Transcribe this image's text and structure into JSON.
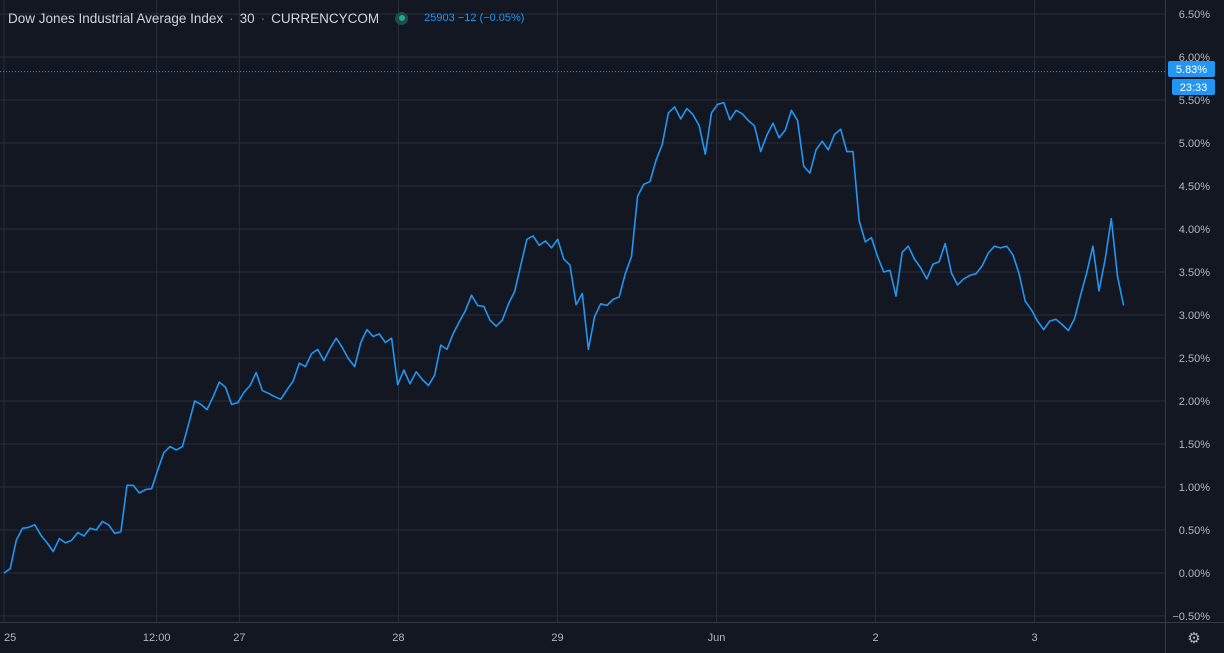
{
  "legend": {
    "title": "Dow Jones Industrial Average Index",
    "interval": "30",
    "source": "CURRENCYCOM",
    "separator": "·",
    "value_text": "25903  −12 (−0.05%)"
  },
  "badges": {
    "last_value": "5.83%",
    "countdown": "23:33"
  },
  "colors": {
    "background": "#131722",
    "grid": "#2a2e39",
    "line": "#2196f3",
    "text": "#b2b5be",
    "status": "#26a69a"
  },
  "icons": {
    "settings": "gear-icon"
  },
  "chart_data": {
    "type": "line",
    "y_unit": "percent",
    "ylim": [
      -0.5,
      6.5
    ],
    "y_ticks": [
      {
        "value": 6.5,
        "label": "6.50%"
      },
      {
        "value": 6.0,
        "label": "6.00%"
      },
      {
        "value": 5.5,
        "label": "5.50%"
      },
      {
        "value": 5.0,
        "label": "5.00%"
      },
      {
        "value": 4.5,
        "label": "4.50%"
      },
      {
        "value": 4.0,
        "label": "4.00%"
      },
      {
        "value": 3.5,
        "label": "3.50%"
      },
      {
        "value": 3.0,
        "label": "3.00%"
      },
      {
        "value": 2.5,
        "label": "2.50%"
      },
      {
        "value": 2.0,
        "label": "2.00%"
      },
      {
        "value": 1.5,
        "label": "1.50%"
      },
      {
        "value": 1.0,
        "label": "1.00%"
      },
      {
        "value": 0.5,
        "label": "0.50%"
      },
      {
        "value": 0.0,
        "label": "0.00%"
      },
      {
        "value": -0.5,
        "label": "−0.50%"
      }
    ],
    "x_ticks": [
      {
        "label": "25",
        "bar": 0
      },
      {
        "label": "12:00",
        "bar": 24
      },
      {
        "label": "27",
        "bar": 37
      },
      {
        "label": "28",
        "bar": 62
      },
      {
        "label": "29",
        "bar": 87
      },
      {
        "label": "Jun",
        "bar": 112
      },
      {
        "label": "2",
        "bar": 137
      },
      {
        "label": "3",
        "bar": 162
      }
    ],
    "bars_total": 177,
    "grid": true,
    "last_value_line": 5.83,
    "series": [
      {
        "values": [
          0.0,
          0.05,
          0.38,
          0.52,
          0.53,
          0.56,
          0.44,
          0.35,
          0.25,
          0.4,
          0.35,
          0.38,
          0.47,
          0.43,
          0.52,
          0.5,
          0.6,
          0.56,
          0.46,
          0.48,
          1.02,
          1.02,
          0.93,
          0.97,
          0.98,
          1.2,
          1.4,
          1.47,
          1.43,
          1.47,
          1.73,
          2.0,
          1.96,
          1.9,
          2.05,
          2.22,
          2.16,
          1.96,
          1.98,
          2.1,
          2.18,
          2.33,
          2.12,
          2.09,
          2.05,
          2.02,
          2.13,
          2.23,
          2.44,
          2.4,
          2.55,
          2.6,
          2.47,
          2.61,
          2.73,
          2.62,
          2.49,
          2.4,
          2.68,
          2.83,
          2.75,
          2.78,
          2.68,
          2.73,
          2.19,
          2.36,
          2.2,
          2.34,
          2.25,
          2.18,
          2.3,
          2.65,
          2.6,
          2.78,
          2.92,
          3.05,
          3.23,
          3.11,
          3.1,
          2.94,
          2.87,
          2.94,
          3.13,
          3.27,
          3.58,
          3.88,
          3.92,
          3.81,
          3.86,
          3.78,
          3.88,
          3.65,
          3.58,
          3.12,
          3.25,
          2.6,
          2.98,
          3.13,
          3.11,
          3.18,
          3.21,
          3.48,
          3.68,
          4.38,
          4.52,
          4.55,
          4.8,
          4.98,
          5.35,
          5.42,
          5.28,
          5.4,
          5.33,
          5.2,
          4.87,
          5.35,
          5.45,
          5.47,
          5.27,
          5.38,
          5.34,
          5.26,
          5.2,
          4.9,
          5.09,
          5.23,
          5.06,
          5.15,
          5.38,
          5.26,
          4.73,
          4.65,
          4.92,
          5.02,
          4.92,
          5.1,
          5.16,
          4.9,
          4.9,
          4.1,
          3.85,
          3.9,
          3.68,
          3.5,
          3.52,
          3.22,
          3.73,
          3.8,
          3.65,
          3.55,
          3.42,
          3.59,
          3.62,
          3.83,
          3.49,
          3.35,
          3.42,
          3.46,
          3.48,
          3.57,
          3.72,
          3.8,
          3.78,
          3.8,
          3.7,
          3.48,
          3.16,
          3.06,
          2.93,
          2.83,
          2.93,
          2.95,
          2.89,
          2.82,
          2.95,
          3.23,
          3.49,
          3.8,
          3.28,
          3.65,
          4.12,
          3.45,
          3.11
        ]
      }
    ]
  }
}
